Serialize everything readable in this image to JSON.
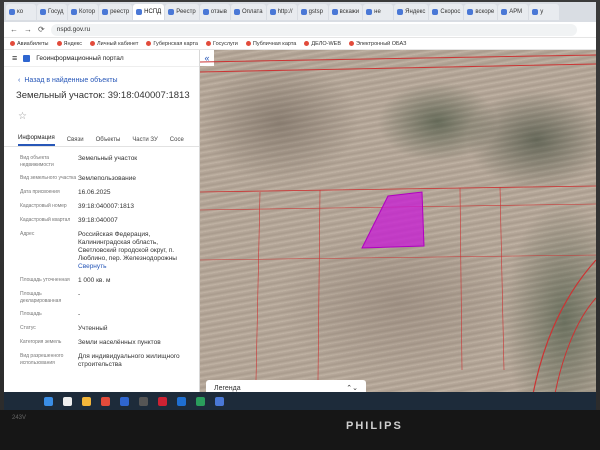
{
  "browser": {
    "tabs": [
      {
        "label": "ко"
      },
      {
        "label": "Госуд"
      },
      {
        "label": "Котор"
      },
      {
        "label": "реестр"
      },
      {
        "label": "НСПД"
      },
      {
        "label": "Реестр"
      },
      {
        "label": "отзыв"
      },
      {
        "label": "Оплата"
      },
      {
        "label": "http://"
      },
      {
        "label": "gstsp"
      },
      {
        "label": "вскажи"
      },
      {
        "label": "не"
      },
      {
        "label": "Яндекс"
      },
      {
        "label": "Скорос"
      },
      {
        "label": "вскоре"
      },
      {
        "label": "АРМ"
      },
      {
        "label": "у"
      }
    ],
    "url": "nspd.gov.ru",
    "bookmarks": [
      "Авиабилеты",
      "Яндекс",
      "Личный кабинет",
      "Губернская карта",
      "Госуслуги",
      "Публичная карта",
      "ДЕЛО-WEB",
      "Электронный ОБАЗ"
    ]
  },
  "panel": {
    "app_title": "Геоинформационный портал",
    "window_title": "НСПД | Геоинформационный портал",
    "back_label": "Назад в найденные объекты",
    "object_title": "Земельный участок: 39:18:040007:1813",
    "tabs": [
      "Информация",
      "Связи",
      "Объекты",
      "Части ЗУ",
      "Сосе"
    ],
    "rows": [
      {
        "k": "Вид объекта недвижимости",
        "v": "Земельный участок"
      },
      {
        "k": "Вид земельного участка",
        "v": "Землепользование"
      },
      {
        "k": "Дата присвоения",
        "v": "16.06.2025"
      },
      {
        "k": "Кадастровый номер",
        "v": "39:18:040007:1813"
      },
      {
        "k": "Кадастровый квартал",
        "v": "39:18:040007"
      },
      {
        "k": "Адрес",
        "v": "Российская Федерация, Калининградская область, Светловский городской округ, п. Люблино, пер. Железнодорожны"
      },
      {
        "k": "Площадь уточненная",
        "v": "1 000 кв. м"
      },
      {
        "k": "Площадь декларированная",
        "v": "-"
      },
      {
        "k": "Площадь",
        "v": "-"
      },
      {
        "k": "Статус",
        "v": "Учтенный"
      },
      {
        "k": "Категория земель",
        "v": "Земли населённых пунктов"
      },
      {
        "k": "Вид разрешенного использования",
        "v": "Для индивидуального жилищного строительства"
      }
    ],
    "more_label": "Свернуть"
  },
  "map": {
    "legend_label": "Легенда",
    "parcel_color": "#c81ad6"
  },
  "monitor": {
    "brand": "PHILIPS",
    "model": "243V"
  }
}
